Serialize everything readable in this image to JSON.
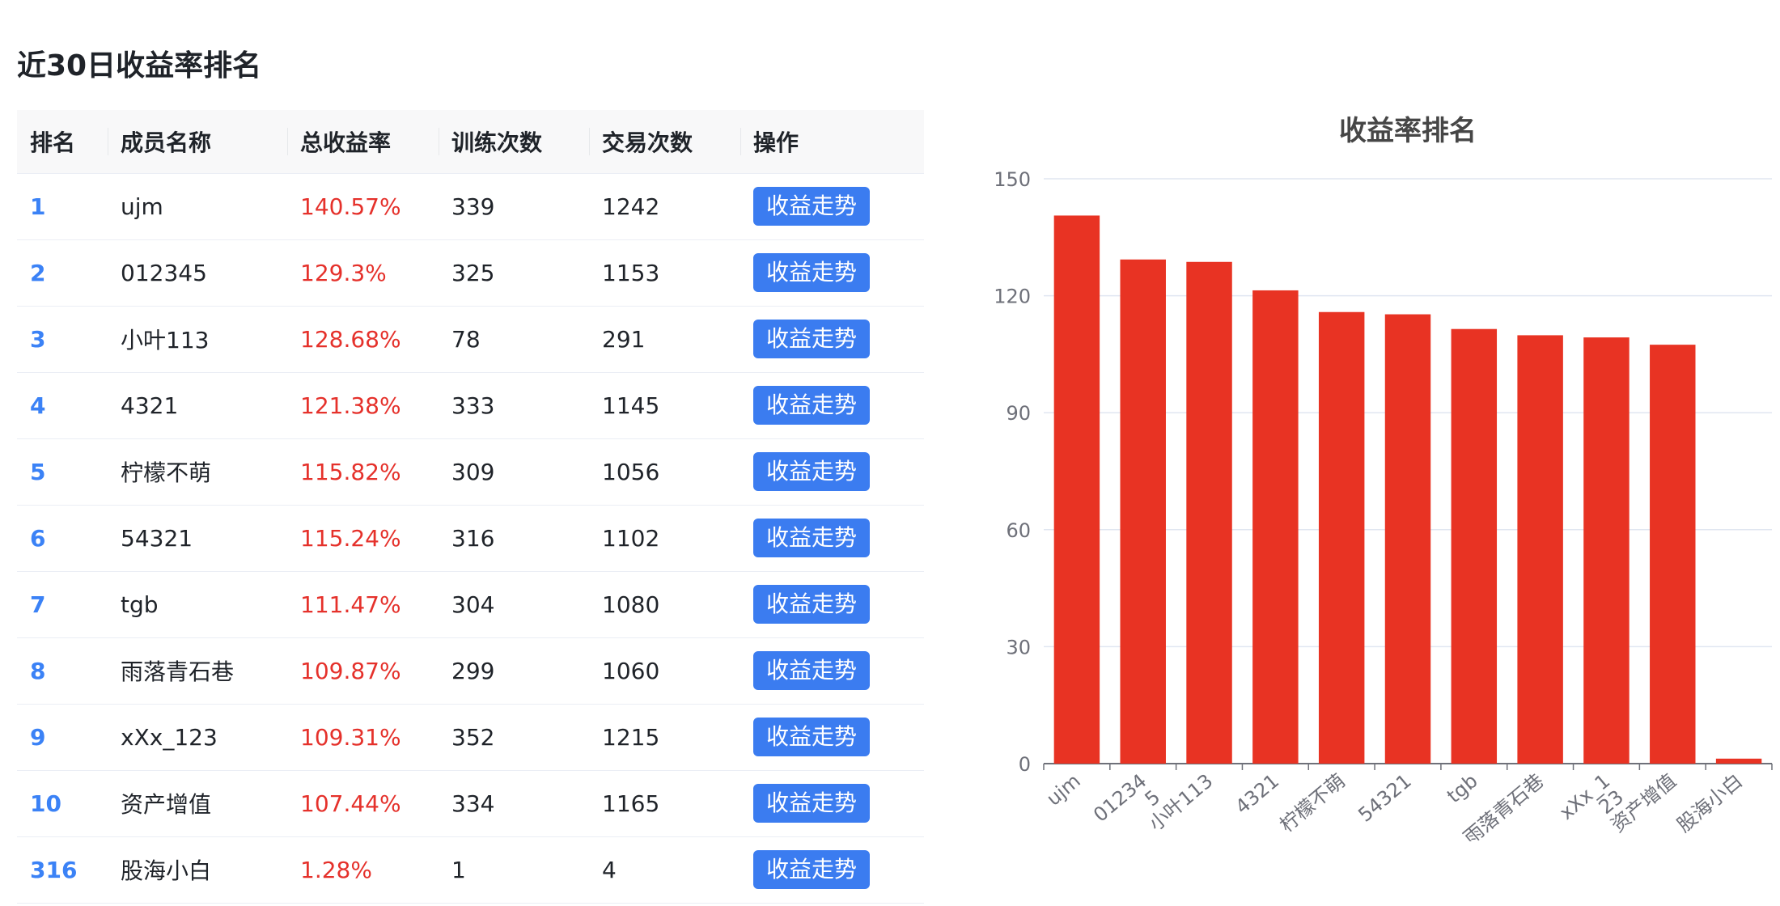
{
  "page": {
    "title": "近30日收益率排名"
  },
  "table": {
    "headers": [
      "排名",
      "成员名称",
      "总收益率",
      "训练次数",
      "交易次数",
      "操作"
    ],
    "rows": [
      {
        "rank": "1",
        "name": "ujm",
        "rate": "140.57%",
        "train": "339",
        "trade": "1242",
        "action": "收益走势"
      },
      {
        "rank": "2",
        "name": "012345",
        "rate": "129.3%",
        "train": "325",
        "trade": "1153",
        "action": "收益走势"
      },
      {
        "rank": "3",
        "name": "小叶113",
        "rate": "128.68%",
        "train": "78",
        "trade": "291",
        "action": "收益走势"
      },
      {
        "rank": "4",
        "name": "4321",
        "rate": "121.38%",
        "train": "333",
        "trade": "1145",
        "action": "收益走势"
      },
      {
        "rank": "5",
        "name": "柠檬不萌",
        "rate": "115.82%",
        "train": "309",
        "trade": "1056",
        "action": "收益走势"
      },
      {
        "rank": "6",
        "name": "54321",
        "rate": "115.24%",
        "train": "316",
        "trade": "1102",
        "action": "收益走势"
      },
      {
        "rank": "7",
        "name": "tgb",
        "rate": "111.47%",
        "train": "304",
        "trade": "1080",
        "action": "收益走势"
      },
      {
        "rank": "8",
        "name": "雨落青石巷",
        "rate": "109.87%",
        "train": "299",
        "trade": "1060",
        "action": "收益走势"
      },
      {
        "rank": "9",
        "name": "xXx_123",
        "rate": "109.31%",
        "train": "352",
        "trade": "1215",
        "action": "收益走势"
      },
      {
        "rank": "10",
        "name": "资产增值",
        "rate": "107.44%",
        "train": "334",
        "trade": "1165",
        "action": "收益走势"
      },
      {
        "rank": "316",
        "name": "股海小白",
        "rate": "1.28%",
        "train": "1",
        "trade": "4",
        "action": "收益走势"
      }
    ]
  },
  "colors": {
    "accent": "#3b7cf0",
    "rank": "#3b82f6",
    "rate": "#e5312b",
    "bar": "#e83323"
  },
  "chart_data": {
    "type": "bar",
    "title": "收益率排名",
    "categories": [
      "ujm",
      "012345",
      "小叶113",
      "4321",
      "柠檬不萌",
      "54321",
      "tgb",
      "雨落青石巷",
      "xXx_123",
      "资产增值",
      "股海小白"
    ],
    "tick_labels": [
      [
        "ujm"
      ],
      [
        "01234",
        "5"
      ],
      [
        "小叶113"
      ],
      [
        "4321"
      ],
      [
        "柠檬不萌"
      ],
      [
        "54321"
      ],
      [
        "tgb"
      ],
      [
        "雨落青石巷"
      ],
      [
        "xXx_1",
        "23"
      ],
      [
        "资产增值"
      ],
      [
        "股海小白"
      ]
    ],
    "series": [
      {
        "values": [
          140.57,
          129.3,
          128.68,
          121.38,
          115.82,
          115.24,
          111.47,
          109.87,
          109.31,
          107.44,
          1.28
        ]
      }
    ],
    "yticks": [
      0,
      30,
      60,
      90,
      120,
      150
    ],
    "ylim": [
      0,
      150
    ],
    "grid": true,
    "xlabel": "",
    "ylabel": ""
  }
}
